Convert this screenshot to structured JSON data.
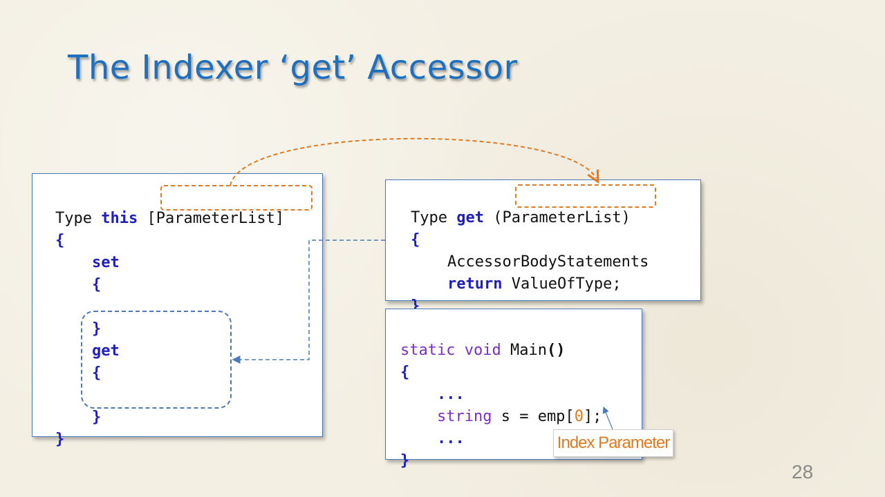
{
  "slide": {
    "title": "The Indexer ‘get’ Accessor",
    "page_number": "28"
  },
  "left_box": {
    "line1_type": "Type ",
    "line1_this": "this",
    "line1_space": " ",
    "line1_param": "[ParameterList]",
    "open_brace": "{",
    "set_kw": "set",
    "set_open": "{",
    "set_close": "}",
    "get_kw": "get",
    "get_open": "{",
    "get_close": "}",
    "close_brace": "}"
  },
  "right_top_box": {
    "type": "Type ",
    "get_kw": "get",
    "space": " ",
    "param": "(ParameterList)",
    "open_brace": "{",
    "body": "AccessorBodyStatements",
    "return_kw": "return",
    "return_val": " ValueOfType;",
    "close_brace": "}"
  },
  "right_bottom_box": {
    "static_kw": "static",
    "void_kw": "void",
    "main_name": "Main",
    "main_parens": "()",
    "open_brace": "{",
    "dots1": "...",
    "string_kw": "string",
    "assign_mid": " s = emp[",
    "index": "0",
    "assign_end": "];",
    "dots2": "...",
    "close_brace": "}"
  },
  "callout": {
    "label": "Index Parameter"
  },
  "colors": {
    "title": "#1f6fbf",
    "keyword": "#1f1fbf",
    "keyword_purple": "#7a2fc0",
    "orange": "#e07a20",
    "dashed_blue": "#4a78b8"
  }
}
